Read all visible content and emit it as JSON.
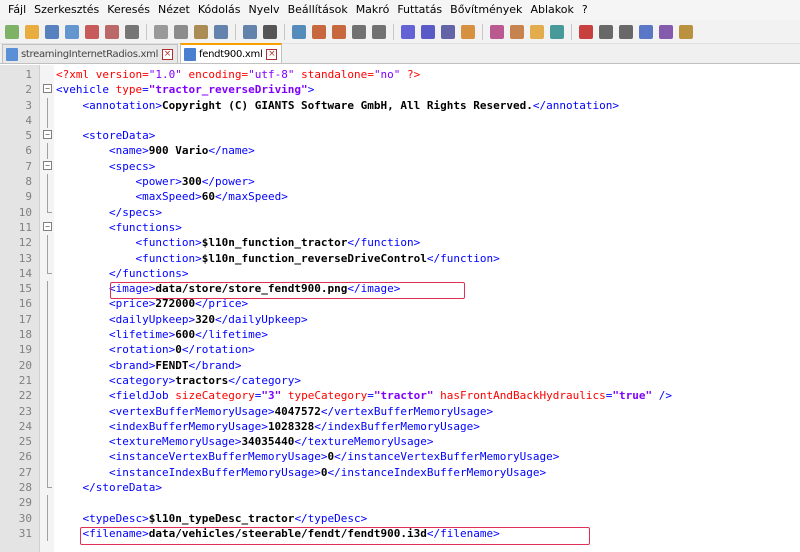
{
  "menu": [
    "Fájl",
    "Szerkesztés",
    "Keresés",
    "Nézet",
    "Kódolás",
    "Nyelv",
    "Beállítások",
    "Makró",
    "Futtatás",
    "Bővítmények",
    "Ablakok",
    "?"
  ],
  "toolbar_icons": [
    "new-file-icon",
    "open-file-icon",
    "save-icon",
    "save-all-icon",
    "close-icon",
    "close-all-icon",
    "print-icon",
    "cut-icon",
    "copy-icon",
    "paste-icon",
    "undo-icon",
    "redo-icon",
    "find-icon",
    "replace-icon",
    "zoom-in-icon",
    "zoom-out-icon",
    "sync-vertical-icon",
    "sync-horizontal-icon",
    "word-wrap-icon",
    "show-all-chars-icon",
    "indent-guide-icon",
    "user-lang-icon",
    "doc-map-icon",
    "function-list-icon",
    "folder-workspace-icon",
    "monitor-icon",
    "record-macro-icon",
    "stop-macro-icon",
    "play-macro-icon",
    "run-macro-multiple-icon",
    "save-macro-icon",
    "spellcheck-icon"
  ],
  "tabs": [
    {
      "label": "streamingInternetRadios.xml",
      "active": false
    },
    {
      "label": "fendt900.xml",
      "active": true
    }
  ],
  "colors": {
    "accent": "#f7a000",
    "highlight_box": "#e0305a",
    "tag": "#0000ff",
    "attr": "#ff0000",
    "string": "#8000ff"
  },
  "lines": [
    {
      "n": "1",
      "fold": "",
      "html": "<span class='decl'>&lt;?xml </span><span class='attr'>version</span><span class='decl'>=</span><span class='str' style='font-weight:normal'>\"1.0\"</span><span class='attr'> encoding</span><span class='decl'>=</span><span class='str' style='font-weight:normal'>\"utf-8\"</span><span class='attr'> standalone</span><span class='decl'>=</span><span class='str' style='font-weight:normal'>\"no\"</span><span class='decl'> ?&gt;</span>"
    },
    {
      "n": "2",
      "fold": "open",
      "html": "<span class='tag'>&lt;vehicle </span><span class='attr'>type</span><span class='tag'>=</span><span class='str'>\"tractor_reverseDriving\"</span><span class='tag'>&gt;</span>"
    },
    {
      "n": "3",
      "fold": "line",
      "html": "    <span class='tag'>&lt;annotation&gt;</span><span class='txt'>Copyright (C) GIANTS Software GmbH, All Rights Reserved.</span><span class='tag'>&lt;/annotation&gt;</span>"
    },
    {
      "n": "4",
      "fold": "line",
      "html": ""
    },
    {
      "n": "5",
      "fold": "open",
      "html": "    <span class='tag'>&lt;storeData&gt;</span>"
    },
    {
      "n": "6",
      "fold": "line",
      "html": "        <span class='tag'>&lt;name&gt;</span><span class='txt'>900 Vario</span><span class='tag'>&lt;/name&gt;</span>"
    },
    {
      "n": "7",
      "fold": "open",
      "html": "        <span class='tag'>&lt;specs&gt;</span>"
    },
    {
      "n": "8",
      "fold": "line",
      "html": "            <span class='tag'>&lt;power&gt;</span><span class='txt'>300</span><span class='tag'>&lt;/power&gt;</span>"
    },
    {
      "n": "9",
      "fold": "line",
      "html": "            <span class='tag'>&lt;maxSpeed&gt;</span><span class='txt'>60</span><span class='tag'>&lt;/maxSpeed&gt;</span>"
    },
    {
      "n": "10",
      "fold": "end",
      "html": "        <span class='tag'>&lt;/specs&gt;</span>"
    },
    {
      "n": "11",
      "fold": "open",
      "html": "        <span class='tag'>&lt;functions&gt;</span>"
    },
    {
      "n": "12",
      "fold": "line",
      "html": "            <span class='tag'>&lt;function&gt;</span><span class='txt'>$l10n_function_tractor</span><span class='tag'>&lt;/function&gt;</span>"
    },
    {
      "n": "13",
      "fold": "line",
      "html": "            <span class='tag'>&lt;function&gt;</span><span class='txt'>$l10n_function_reverseDriveControl</span><span class='tag'>&lt;/function&gt;</span>"
    },
    {
      "n": "14",
      "fold": "end",
      "html": "        <span class='tag'>&lt;/functions&gt;</span>"
    },
    {
      "n": "15",
      "fold": "line",
      "html": "        <span class='tag'>&lt;image&gt;</span><span class='txt'>data/store/store_fendt900.png</span><span class='tag'>&lt;/image&gt;</span>"
    },
    {
      "n": "16",
      "fold": "line",
      "html": "        <span class='tag'>&lt;price&gt;</span><span class='txt'>272000</span><span class='tag'>&lt;/price&gt;</span>"
    },
    {
      "n": "17",
      "fold": "line",
      "html": "        <span class='tag'>&lt;dailyUpkeep&gt;</span><span class='txt'>320</span><span class='tag'>&lt;/dailyUpkeep&gt;</span>"
    },
    {
      "n": "18",
      "fold": "line",
      "html": "        <span class='tag'>&lt;lifetime&gt;</span><span class='txt'>600</span><span class='tag'>&lt;/lifetime&gt;</span>"
    },
    {
      "n": "19",
      "fold": "line",
      "html": "        <span class='tag'>&lt;rotation&gt;</span><span class='txt'>0</span><span class='tag'>&lt;/rotation&gt;</span>"
    },
    {
      "n": "20",
      "fold": "line",
      "html": "        <span class='tag'>&lt;brand&gt;</span><span class='txt'>FENDT</span><span class='tag'>&lt;/brand&gt;</span>"
    },
    {
      "n": "21",
      "fold": "line",
      "html": "        <span class='tag'>&lt;category&gt;</span><span class='txt'>tractors</span><span class='tag'>&lt;/category&gt;</span>"
    },
    {
      "n": "22",
      "fold": "line",
      "html": "        <span class='tag'>&lt;fieldJob </span><span class='attr'>sizeCategory</span><span class='tag'>=</span><span class='str'>\"3\"</span><span class='attr'> typeCategory</span><span class='tag'>=</span><span class='str'>\"tractor\"</span><span class='attr'> hasFrontAndBackHydraulics</span><span class='tag'>=</span><span class='str'>\"true\"</span><span class='tag'> /&gt;</span>"
    },
    {
      "n": "23",
      "fold": "line",
      "html": "        <span class='tag'>&lt;vertexBufferMemoryUsage&gt;</span><span class='txt'>4047572</span><span class='tag'>&lt;/vertexBufferMemoryUsage&gt;</span>"
    },
    {
      "n": "24",
      "fold": "line",
      "html": "        <span class='tag'>&lt;indexBufferMemoryUsage&gt;</span><span class='txt'>1028328</span><span class='tag'>&lt;/indexBufferMemoryUsage&gt;</span>"
    },
    {
      "n": "25",
      "fold": "line",
      "html": "        <span class='tag'>&lt;textureMemoryUsage&gt;</span><span class='txt'>34035440</span><span class='tag'>&lt;/textureMemoryUsage&gt;</span>"
    },
    {
      "n": "26",
      "fold": "line",
      "html": "        <span class='tag'>&lt;instanceVertexBufferMemoryUsage&gt;</span><span class='txt'>0</span><span class='tag'>&lt;/instanceVertexBufferMemoryUsage&gt;</span>"
    },
    {
      "n": "27",
      "fold": "line",
      "html": "        <span class='tag'>&lt;instanceIndexBufferMemoryUsage&gt;</span><span class='txt'>0</span><span class='tag'>&lt;/instanceIndexBufferMemoryUsage&gt;</span>"
    },
    {
      "n": "28",
      "fold": "end",
      "html": "    <span class='tag'>&lt;/storeData&gt;</span>"
    },
    {
      "n": "29",
      "fold": "line",
      "html": ""
    },
    {
      "n": "30",
      "fold": "line",
      "html": "    <span class='tag'>&lt;typeDesc&gt;</span><span class='txt'>$l10n_typeDesc_tractor</span><span class='tag'>&lt;/typeDesc&gt;</span>"
    },
    {
      "n": "31",
      "fold": "line",
      "html": "    <span class='tag'>&lt;filename&gt;</span><span class='txt'>data/vehicles/steerable/fendt/fendt900.i3d</span><span class='tag'>&lt;/filename&gt;</span>"
    }
  ]
}
